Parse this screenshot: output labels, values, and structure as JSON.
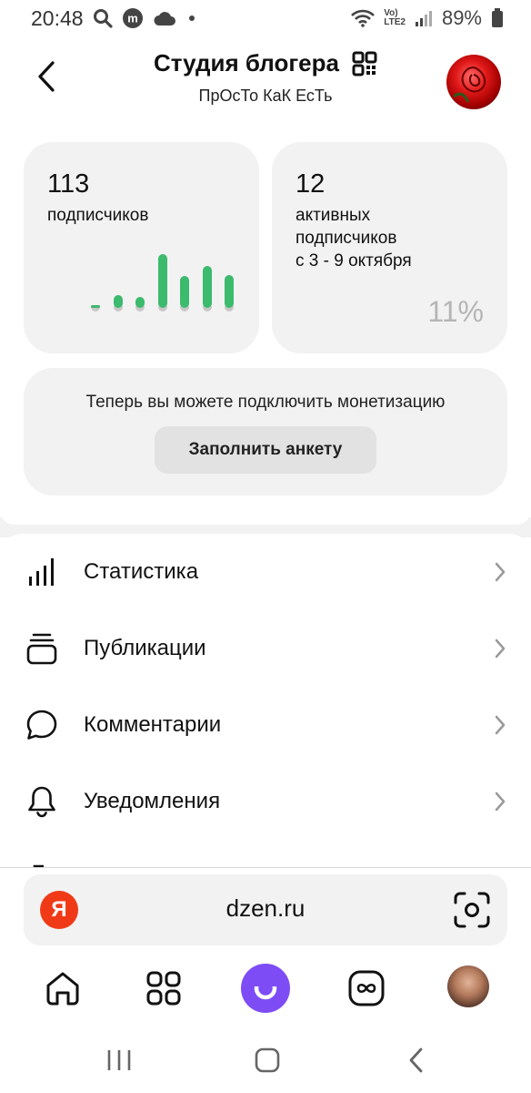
{
  "status_bar": {
    "time": "20:48",
    "network_label_top": "Vo)",
    "network_label_bottom": "LTE2",
    "battery": "89%",
    "icons": [
      "search-icon",
      "m-app-icon",
      "cloud-icon",
      "dot-icon",
      "wifi-icon",
      "signal-icon",
      "battery-icon"
    ]
  },
  "header": {
    "title": "Студия блогера",
    "subtitle": "ПрОсТо КаК ЕсТь",
    "icons": [
      "back-arrow-icon",
      "qr-code-icon",
      "rose-avatar"
    ]
  },
  "stats": {
    "subscribers": {
      "count": "113",
      "label": "подписчиков",
      "bar_levels": [
        0.04,
        0.18,
        0.16,
        0.78,
        0.46,
        0.6,
        0.48
      ]
    },
    "active": {
      "count": "12",
      "label_line1": "активных",
      "label_line2": "подписчиков",
      "label_line3": "с 3 - 9 октября",
      "percent": "11%"
    }
  },
  "monetization": {
    "text": "Теперь вы можете подключить монетизацию",
    "button_label": "Заполнить анкету"
  },
  "menu": {
    "items": [
      {
        "label": "Статистика",
        "icon": "bar-chart-icon"
      },
      {
        "label": "Публикации",
        "icon": "stack-icon"
      },
      {
        "label": "Комментарии",
        "icon": "speech-bubble-icon"
      },
      {
        "label": "Уведомления",
        "icon": "bell-icon"
      }
    ]
  },
  "browser": {
    "logo_letter": "Я",
    "url": "dzen.ru",
    "icons": [
      "yandex-logo",
      "scan-camera-icon"
    ]
  },
  "bottom_nav": {
    "icons": [
      "home-icon",
      "apps-grid-icon",
      "alice-icon",
      "infinity-icon",
      "profile-avatar"
    ],
    "alice_color": "#7d4cf5"
  },
  "colors": {
    "card_bg": "#f2f2f2",
    "bar_green": "#3cba6e",
    "yandex_red": "#f03a17"
  }
}
